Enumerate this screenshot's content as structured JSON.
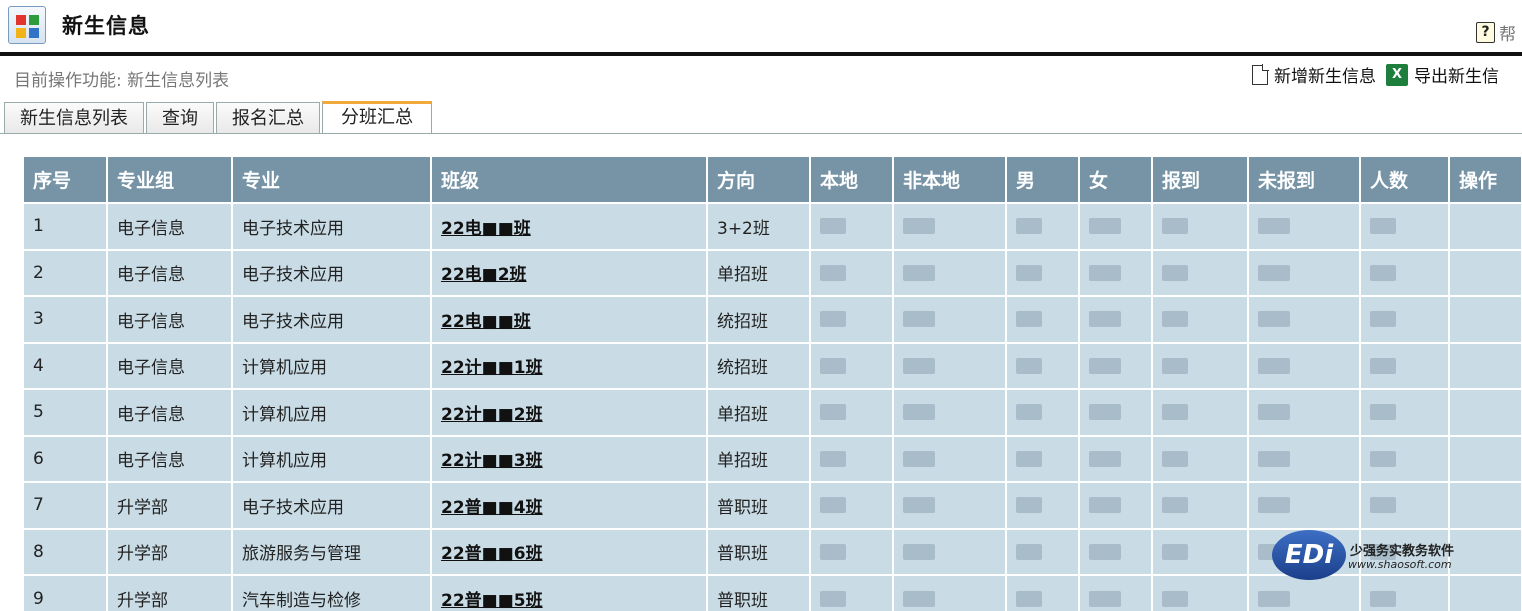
{
  "header": {
    "title": "新生信息",
    "help_label": "帮",
    "help_glyph": "?",
    "app_icon": "app-grid-icon"
  },
  "operation": {
    "prefix": "目前操作功能:",
    "current": "新生信息列表"
  },
  "actions": {
    "add_label": "新增新生信息",
    "add_icon": "document-icon",
    "export_label": "导出新生信",
    "export_icon": "excel-icon",
    "export_glyph": "X"
  },
  "tabs": [
    {
      "label": "新生信息列表"
    },
    {
      "label": "查询"
    },
    {
      "label": "报名汇总"
    },
    {
      "label": "分班汇总",
      "active": true
    }
  ],
  "table": {
    "columns": [
      "序号",
      "专业组",
      "专业",
      "班级",
      "方向",
      "本地",
      "非本地",
      "男",
      "女",
      "报到",
      "未报到",
      "人数",
      "操作"
    ],
    "rows": [
      {
        "no": "1",
        "group": "电子信息",
        "major": "电子技术应用",
        "class": "22电■■班",
        "direction": "3+2班"
      },
      {
        "no": "2",
        "group": "电子信息",
        "major": "电子技术应用",
        "class": "22电■2班",
        "direction": "单招班"
      },
      {
        "no": "3",
        "group": "电子信息",
        "major": "电子技术应用",
        "class": "22电■■班",
        "direction": "统招班"
      },
      {
        "no": "4",
        "group": "电子信息",
        "major": "计算机应用",
        "class": "22计■■1班",
        "direction": "统招班"
      },
      {
        "no": "5",
        "group": "电子信息",
        "major": "计算机应用",
        "class": "22计■■2班",
        "direction": "单招班"
      },
      {
        "no": "6",
        "group": "电子信息",
        "major": "计算机应用",
        "class": "22计■■3班",
        "direction": "单招班"
      },
      {
        "no": "7",
        "group": "升学部",
        "major": "电子技术应用",
        "class": "22普■■4班",
        "direction": "普职班"
      },
      {
        "no": "8",
        "group": "升学部",
        "major": "旅游服务与管理",
        "class": "22普■■6班",
        "direction": "普职班"
      },
      {
        "no": "9",
        "group": "升学部",
        "major": "汽车制造与检修",
        "class": "22普■■5班",
        "direction": "普职班"
      }
    ]
  },
  "watermark": {
    "logo": "EDi",
    "text": "少强务实教务软件",
    "url": "www.shaosoft.com"
  },
  "colors": {
    "header_bg": "#7694a6",
    "row_bg": "#c9dce6",
    "tab_accent": "#f2a93b"
  }
}
